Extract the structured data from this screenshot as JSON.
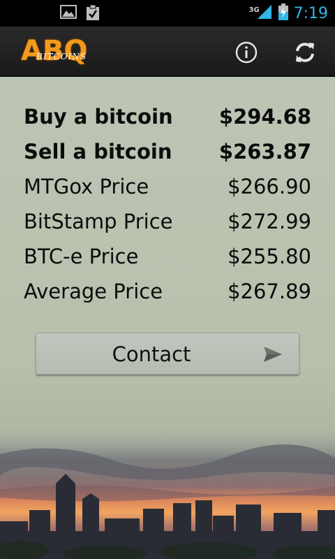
{
  "status_bar": {
    "network": "3G",
    "time": "7:19",
    "icons": [
      "image-notification-icon",
      "clipboard-check-icon",
      "signal-icon",
      "battery-charging-icon"
    ]
  },
  "action_bar": {
    "logo_main": "ABQ",
    "logo_sub": "BITCOINS",
    "info_icon": "info-icon",
    "refresh_icon": "refresh-icon"
  },
  "prices": [
    {
      "label": "Buy a bitcoin",
      "value": "$294.68",
      "bold": true
    },
    {
      "label": "Sell a bitcoin",
      "value": "$263.87",
      "bold": true
    },
    {
      "label": "MTGox Price",
      "value": "$266.90",
      "bold": false
    },
    {
      "label": "BitStamp Price",
      "value": "$272.99",
      "bold": false
    },
    {
      "label": "BTC-e Price",
      "value": "$255.80",
      "bold": false
    },
    {
      "label": "Average Price",
      "value": "$267.89",
      "bold": false
    }
  ],
  "contact_button": {
    "label": "Contact",
    "icon": "send-icon"
  },
  "colors": {
    "accent_blue": "#33b5e5",
    "logo_orange": "#f29a1b",
    "background": "#b9c2b0"
  }
}
